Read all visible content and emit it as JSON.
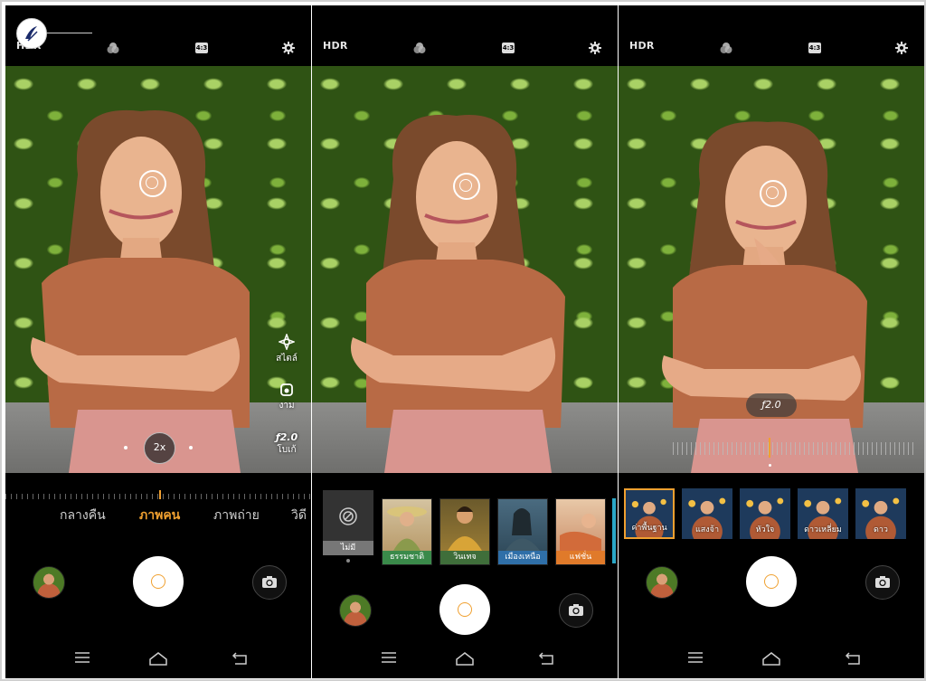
{
  "logo": {
    "name": "watermark-logo"
  },
  "panels": [
    {
      "hdr": "HDR",
      "ratio": "4:3",
      "side_buttons": [
        {
          "icon": "sparkle-icon",
          "label": "สไตล์"
        },
        {
          "icon": "beauty-icon",
          "label": "งาม"
        },
        {
          "icon": "aperture-icon",
          "label": "โบเก้",
          "value": "ƒ2.0"
        }
      ],
      "zoom": "2x",
      "modes": [
        "กลางคืน",
        "ภาพคน",
        "ภาพถ่าย",
        "วิดี"
      ],
      "active_mode": "ภาพคน"
    },
    {
      "hdr": "HDR",
      "ratio": "4:3",
      "none_label": "ไม่มี",
      "styles": [
        {
          "label": "ธรรมชาติ",
          "color": "#3a8a4a"
        },
        {
          "label": "วินเทจ",
          "color": "#3f6e3a"
        },
        {
          "label": "เมืองเหนือ",
          "color": "#2f6fa8"
        },
        {
          "label": "แฟชั่น",
          "color": "#e07a2a"
        }
      ]
    },
    {
      "hdr": "HDR",
      "ratio": "4:3",
      "aperture": "ƒ2.0",
      "beauty_labels": [
        "ค่าพื้นฐาน",
        "แสงจ้า",
        "หัวใจ",
        "ดาวเหลี่ยม",
        "ดาว"
      ]
    }
  ],
  "colors": {
    "accent": "#f0a030",
    "background": "#000000"
  }
}
